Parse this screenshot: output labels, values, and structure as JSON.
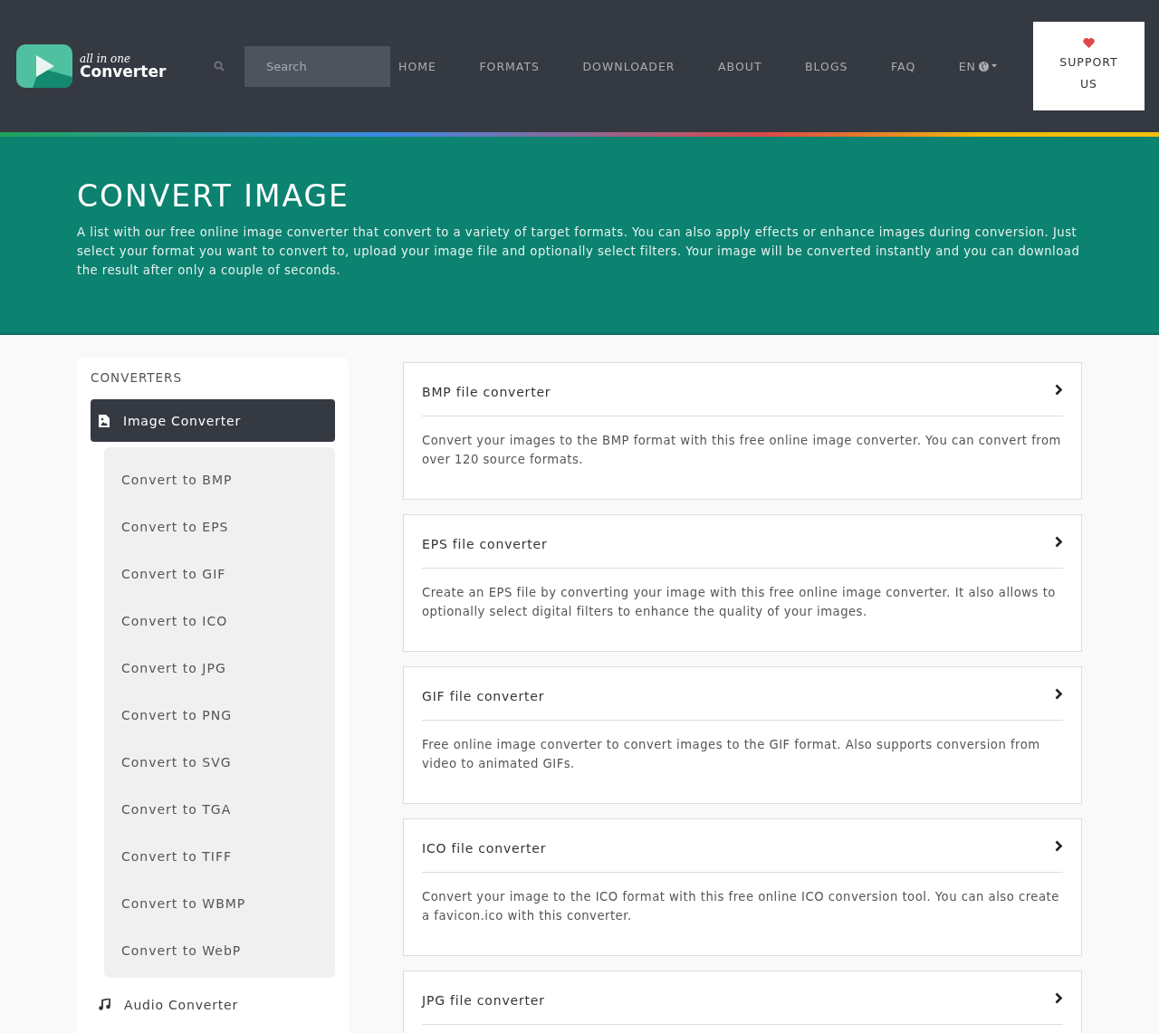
{
  "header": {
    "logo": {
      "tagline": "all in one",
      "name": "Converter"
    },
    "search": {
      "placeholder": "Search"
    },
    "nav": [
      {
        "label": "HOME"
      },
      {
        "label": "FORMATS"
      },
      {
        "label": "DOWNLOADER"
      },
      {
        "label": "ABOUT"
      },
      {
        "label": "BLOGS"
      },
      {
        "label": "FAQ"
      }
    ],
    "language": {
      "label": "EN"
    },
    "support_button": {
      "label": "SUPPORT US"
    }
  },
  "hero": {
    "title": "CONVERT IMAGE",
    "description": "A list with our free online image converter that convert to a variety of target formats. You can also apply effects or enhance images during conversion. Just select your format you want to convert to, upload your image file and optionally select filters. Your image will be converted instantly and you can download the result after only a couple of seconds."
  },
  "sidebar": {
    "heading": "CONVERTERS",
    "items": [
      {
        "label": "Image Converter",
        "kind": "image",
        "selected": true,
        "expanded": true,
        "children": [
          {
            "label": "Convert to BMP"
          },
          {
            "label": "Convert to EPS"
          },
          {
            "label": "Convert to GIF"
          },
          {
            "label": "Convert to ICO"
          },
          {
            "label": "Convert to JPG"
          },
          {
            "label": "Convert to PNG"
          },
          {
            "label": "Convert to SVG"
          },
          {
            "label": "Convert to TGA"
          },
          {
            "label": "Convert to TIFF"
          },
          {
            "label": "Convert to WBMP"
          },
          {
            "label": "Convert to WebP"
          }
        ]
      },
      {
        "label": "Audio Converter",
        "kind": "audio",
        "selected": false,
        "expanded": false
      }
    ]
  },
  "cards": [
    {
      "title": "BMP file converter",
      "description": "Convert your images to the BMP format with this free online image converter. You can convert from over 120 source formats."
    },
    {
      "title": "EPS file converter",
      "description": "Create an EPS file by converting your image with this free online image converter. It also allows to optionally select digital filters to enhance the quality of your images."
    },
    {
      "title": "GIF file converter",
      "description": "Free online image converter to convert images to the GIF format. Also supports conversion from video to animated GIFs."
    },
    {
      "title": "ICO file converter",
      "description": "Convert your image to the ICO format with this free online ICO conversion tool. You can also create a favicon.ico with this converter."
    },
    {
      "title": "JPG file converter"
    }
  ]
}
